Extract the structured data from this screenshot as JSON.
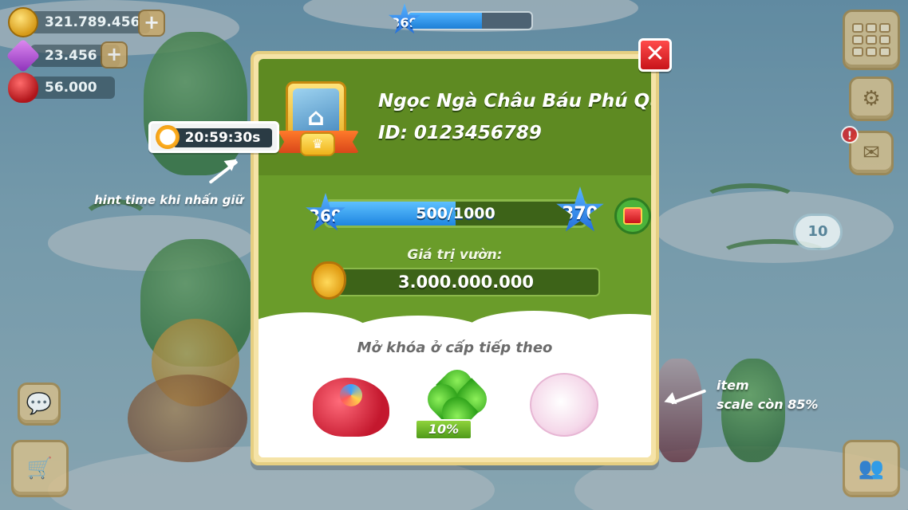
{
  "hud": {
    "gold": "321.789.456",
    "gems": "23.456",
    "hearts": "56.000",
    "top_level": "369",
    "top_level_progress": 0.6,
    "cloud_badge": "10",
    "alert": "!"
  },
  "icons": {
    "gold": "coin-icon",
    "gems": "gem-icon",
    "hearts": "heart-icon",
    "add": "plus-icon",
    "menu": "grid-menu-icon",
    "settings": "gear-icon",
    "mail": "mail-icon",
    "chat": "chat-icon",
    "shop": "shopping-cart-icon",
    "friends": "friends-icon",
    "close": "close-icon",
    "gift": "gift-icon",
    "bag": "money-bag-icon",
    "timer": "stopwatch-icon"
  },
  "timer": {
    "value": "20:59:30s",
    "hint": "hint time khi nhấn giữ"
  },
  "dialog": {
    "player_name": "Ngọc Ngà Châu Báu Phú Quý",
    "player_id": "ID: 0123456789",
    "level_current": "369",
    "level_next": "370",
    "xp_text": "500/1000",
    "xp_fraction": 0.5,
    "garden_label": "Giá trị vườn:",
    "garden_value": "3.000.000.000",
    "unlock_label": "Mở khóa ở cấp tiếp theo",
    "items": [
      {
        "name": "red-sea-creature-item"
      },
      {
        "name": "four-leaf-clover-item",
        "badge": "10%"
      },
      {
        "name": "cotton-flower-item"
      }
    ]
  },
  "annotation": {
    "item_line1": "item",
    "item_line2": "scale còn 85%"
  },
  "colors": {
    "panel_dark_green": "#5e8a22",
    "panel_green": "#6a9c2a",
    "frame_gold": "#f5e3a7",
    "xp_blue": "#1f86e0",
    "close_red": "#c8141a"
  }
}
